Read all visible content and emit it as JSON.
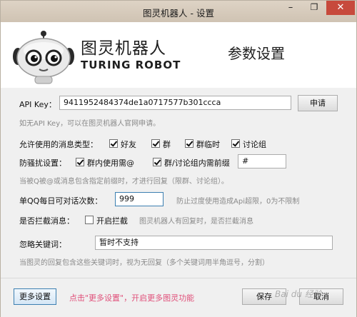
{
  "window": {
    "title": "图灵机器人 - 设置",
    "controls": {
      "minimize": "–",
      "maximize": "❐",
      "close": "✕"
    }
  },
  "header": {
    "brand_cn": "图灵机器人",
    "brand_en": "TURING ROBOT",
    "page_title": "参数设置"
  },
  "api": {
    "label": "API Key：",
    "value": "9411952484374de1a0717577b301ccca",
    "apply_button": "申请",
    "hint": "如无API Key，可以在图灵机器人官网申请。"
  },
  "message_types": {
    "label": "允许使用的消息类型：",
    "options": [
      {
        "label": "好友",
        "checked": true
      },
      {
        "label": "群",
        "checked": true
      },
      {
        "label": "群临时",
        "checked": true
      },
      {
        "label": "讨论组",
        "checked": true
      }
    ]
  },
  "anti_disturb": {
    "label": "防骚扰设置：",
    "option_group_at": {
      "label": "群内使用需@",
      "checked": true
    },
    "option_prefix": {
      "label": "群/讨论组内需前缀",
      "checked": true
    },
    "prefix_value": "#",
    "hint": "当被Q被@或消息包含指定前缀时，才进行回复（限群、讨论组）。"
  },
  "daily_limit": {
    "label": "单QQ每日可对话次数：",
    "value": "999",
    "hint": "防止过度使用造成Api超限，0为不限制"
  },
  "intercept": {
    "label": "是否拦截消息：",
    "checkbox": {
      "label": "开启拦截",
      "checked": false
    },
    "hint": "图灵机器人有回复时，是否拦截消息"
  },
  "ignore_keywords": {
    "label": "忽略关键词：",
    "value": "暂时不支持",
    "hint": "当图灵的回复包含这些关键词时，视为无回复（多个关键词用半角逗号，分割）"
  },
  "footer": {
    "more_button": "更多设置",
    "more_hint": "点击\"更多设置\"，开启更多图灵功能",
    "save_button": "保存",
    "cancel_button": "取消",
    "watermark": "Bai du 经验"
  },
  "colors": {
    "titlebar": "#d8ccbd",
    "close_button": "#c74a3c",
    "focus_border": "#3c7fb1",
    "footer_hint": "#e0507a"
  }
}
